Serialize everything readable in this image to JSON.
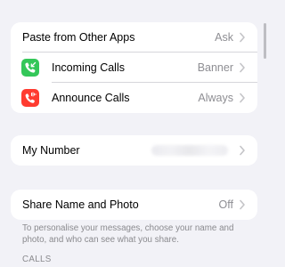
{
  "group1": {
    "paste": {
      "label": "Paste from Other Apps",
      "value": "Ask"
    },
    "incoming": {
      "label": "Incoming Calls",
      "value": "Banner",
      "icon": "phone-incoming-icon",
      "color": "#34c759"
    },
    "announce": {
      "label": "Announce Calls",
      "value": "Always",
      "icon": "phone-announce-icon",
      "color": "#ff3b30"
    }
  },
  "group2": {
    "my_number": {
      "label": "My Number"
    }
  },
  "group3": {
    "share": {
      "label": "Share Name and Photo",
      "value": "Off"
    },
    "footer": "To personalise your messages, choose your name and photo, and who can see what you share."
  },
  "section": {
    "calls_header": "CALLS"
  }
}
